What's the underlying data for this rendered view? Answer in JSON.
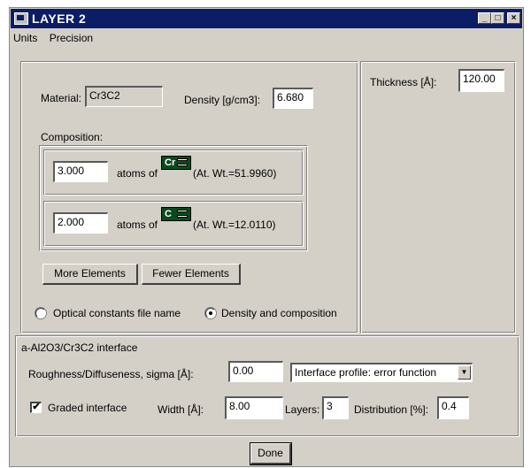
{
  "window": {
    "title": "LAYER 2",
    "buttons": {
      "minimize": "_",
      "maximize": "□",
      "close": "×"
    }
  },
  "menu": {
    "units": "Units",
    "precision": "Precision"
  },
  "material": {
    "label": "Material:",
    "value": "Cr3C2",
    "density_label": "Density [g/cm3]:",
    "density_value": "6.680"
  },
  "composition": {
    "label": "Composition:",
    "rows": [
      {
        "count": "3.000",
        "atoms_of": "atoms of",
        "element": "Cr",
        "atomic_weight": "(At. Wt.=51.9960)"
      },
      {
        "count": "2.000",
        "atoms_of": "atoms of",
        "element": "C",
        "atomic_weight": "(At. Wt.=12.0110)"
      }
    ],
    "more_button": "More Elements",
    "fewer_button": "Fewer Elements"
  },
  "mode": {
    "optical_label": "Optical constants file name",
    "density_label": "Density and composition",
    "selected": "density"
  },
  "thickness": {
    "label": "Thickness [Å]:",
    "value": "120.00"
  },
  "interface": {
    "title": "a-Al2O3/Cr3C2 interface",
    "roughness_label": "Roughness/Diffuseness, sigma [Å]:",
    "roughness_value": "0.00",
    "profile_value": "Interface profile: error function",
    "graded_label": "Graded interface",
    "graded_checked": true,
    "check_mark": "✔",
    "dropdown_arrow": "▼",
    "width_label": "Width [Å]:",
    "width_value": "8.00",
    "layers_label": "Layers:",
    "layers_value": "3",
    "distribution_label": "Distribution [%]:",
    "distribution_value": "0.4"
  },
  "done_button": "Done"
}
